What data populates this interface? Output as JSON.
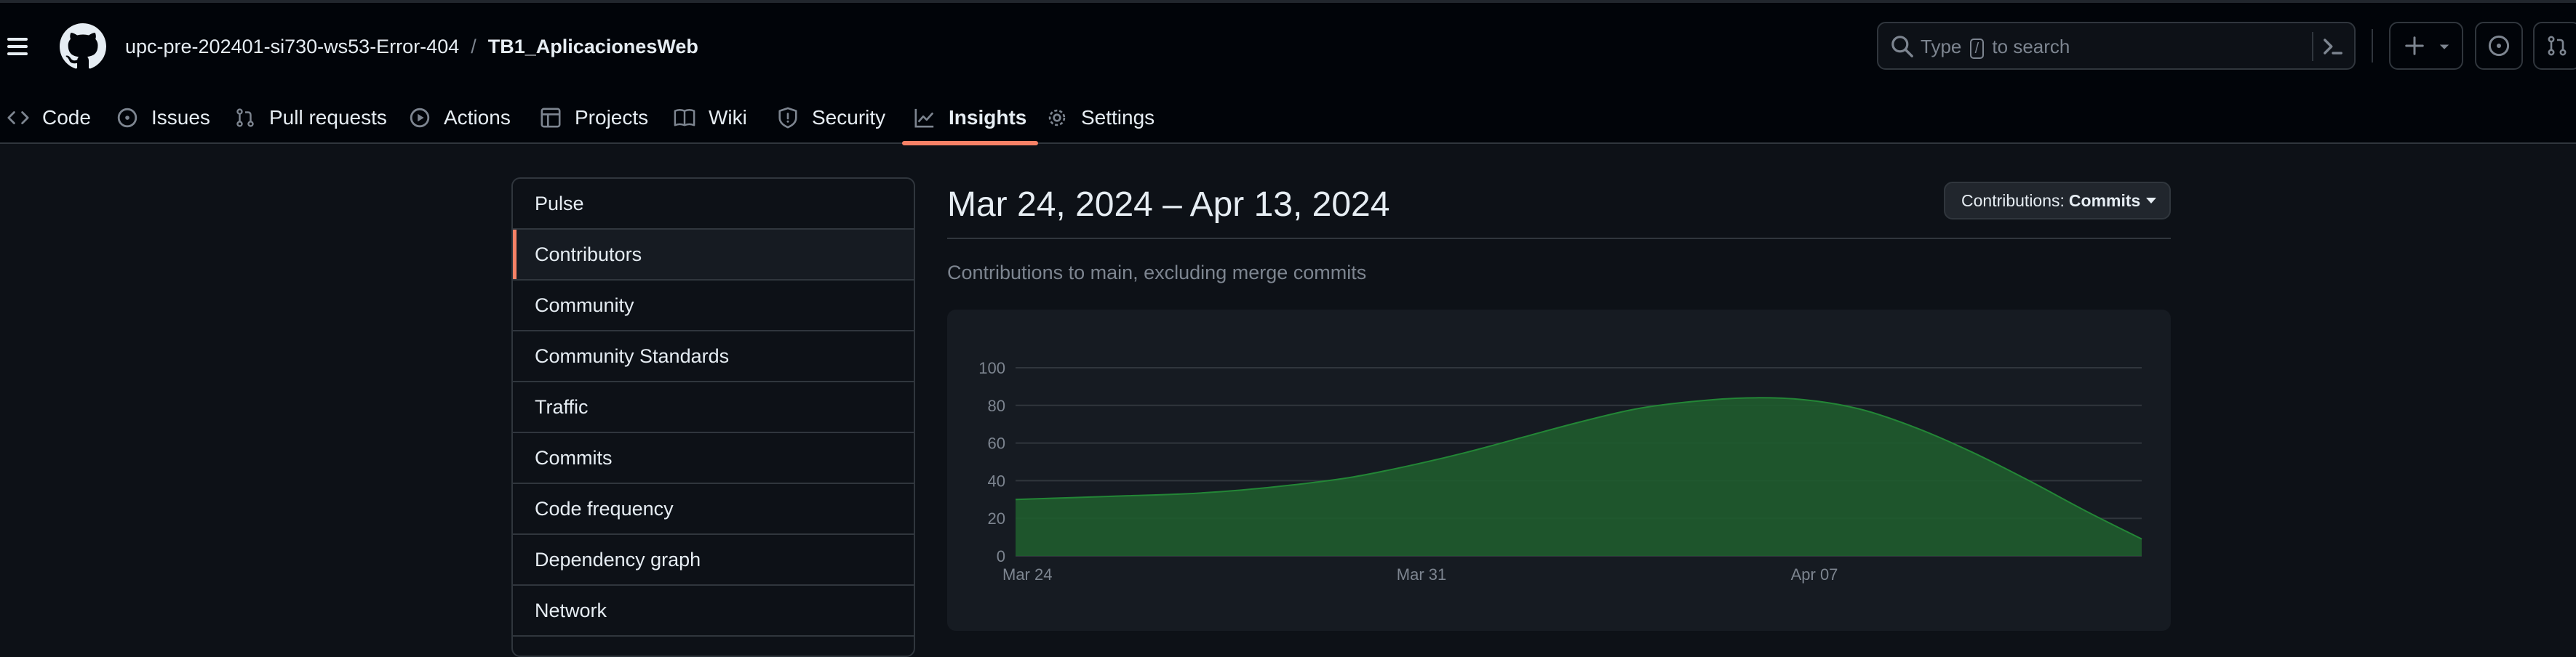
{
  "header": {
    "owner": "upc-pre-202401-si730-ws53-Error-404",
    "separator": "/",
    "repo": "TB1_AplicacionesWeb",
    "search": {
      "prefix": "Type",
      "key": "/",
      "suffix": "to search"
    }
  },
  "tabs": [
    {
      "label": "Code",
      "icon": "code-icon"
    },
    {
      "label": "Issues",
      "icon": "issue-opened-icon"
    },
    {
      "label": "Pull requests",
      "icon": "git-pull-request-icon"
    },
    {
      "label": "Actions",
      "icon": "play-icon"
    },
    {
      "label": "Projects",
      "icon": "table-icon"
    },
    {
      "label": "Wiki",
      "icon": "book-icon"
    },
    {
      "label": "Security",
      "icon": "shield-icon"
    },
    {
      "label": "Insights",
      "icon": "graph-icon",
      "active": true
    },
    {
      "label": "Settings",
      "icon": "gear-icon"
    }
  ],
  "sidebar": {
    "items": [
      {
        "label": "Pulse"
      },
      {
        "label": "Contributors",
        "active": true
      },
      {
        "label": "Community"
      },
      {
        "label": "Community Standards"
      },
      {
        "label": "Traffic"
      },
      {
        "label": "Commits"
      },
      {
        "label": "Code frequency"
      },
      {
        "label": "Dependency graph"
      },
      {
        "label": "Network"
      }
    ]
  },
  "main": {
    "date_range": "Mar 24, 2024 – Apr 13, 2024",
    "contributions_button": {
      "label": "Contributions:",
      "value": "Commits"
    },
    "subtitle": "Contributions to main, excluding merge commits"
  },
  "colors": {
    "accent": "#f78166",
    "area_fill": "#1f5c2e",
    "area_stroke": "#238636"
  },
  "chart_data": {
    "type": "area",
    "x": [
      "Mar 24",
      "Mar 25",
      "Mar 26",
      "Mar 27",
      "Mar 28",
      "Mar 29",
      "Mar 30",
      "Mar 31",
      "Apr 01",
      "Apr 02",
      "Apr 03",
      "Apr 04",
      "Apr 05",
      "Apr 06",
      "Apr 07",
      "Apr 08",
      "Apr 09",
      "Apr 10",
      "Apr 11",
      "Apr 12",
      "Apr 13"
    ],
    "series": [
      {
        "values": [
          30,
          31,
          32,
          33,
          35,
          38,
          42,
          48,
          55,
          63,
          71,
          78,
          82,
          84,
          83,
          78,
          68,
          55,
          40,
          24,
          9
        ]
      }
    ],
    "x_tick_labels": [
      "Mar 24",
      "Mar 31",
      "Apr 07"
    ],
    "y_ticks": [
      0,
      20,
      40,
      60,
      80,
      100
    ],
    "ylim": [
      0,
      100
    ],
    "grid": true
  }
}
